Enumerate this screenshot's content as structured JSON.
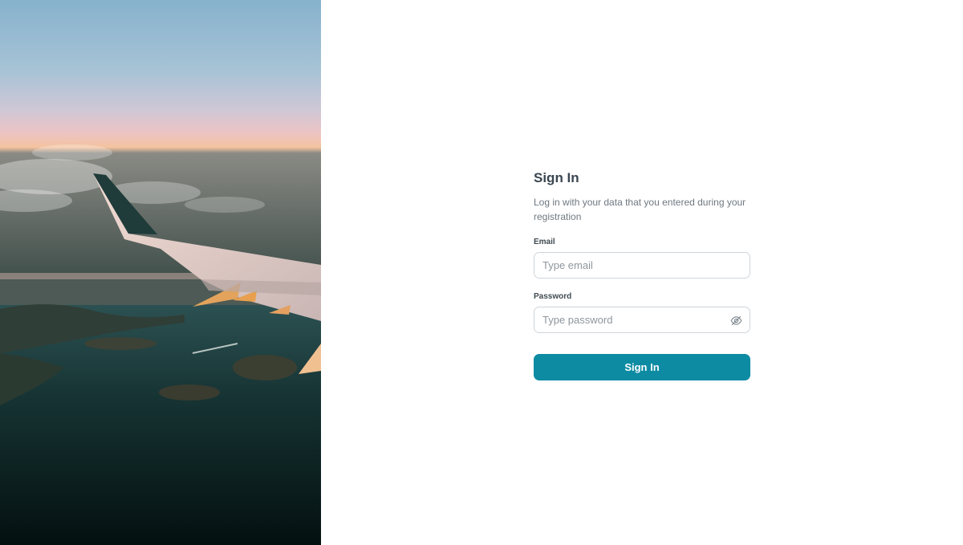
{
  "hero": {
    "image_description_icon": "airplane-wing-photo",
    "colors": {
      "sky_top": "#8fb7cf",
      "sky_mid": "#d9c4d2",
      "horizon": "#f2c2a0",
      "sea": "#1d3a38",
      "sea_dark": "#061412"
    }
  },
  "signin": {
    "title": "Sign In",
    "subtitle": "Log in with your data that you entered during your registration",
    "email": {
      "label": "Email",
      "placeholder": "Type email",
      "value": ""
    },
    "password": {
      "label": "Password",
      "placeholder": "Type password",
      "value": "",
      "toggle_icon": "eye-off-icon"
    },
    "submit_label": "Sign In",
    "accent_color": "#0d8ba3"
  }
}
